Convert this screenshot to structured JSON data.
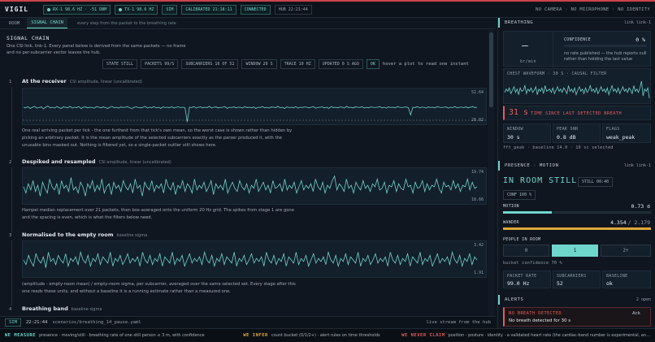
{
  "app": {
    "title": "VIGIL"
  },
  "topbar": {
    "rx": "RX-1 98.6 HZ · -51 DBM",
    "tx": "TX-1 98.6 HZ",
    "sim": "SIM",
    "calibrated": "CALIBRATED 21:18:11",
    "connected": "CONNECTED",
    "hub": "HUB 22:21:44",
    "privacy": "NO CAMERA · NO MICROPHONE · NO IDENTITY"
  },
  "tabs": [
    {
      "label": "ROOM"
    },
    {
      "label": "SIGNAL CHAIN"
    }
  ],
  "tab_desc": "every step from the packet to the breathing rate",
  "chain": {
    "title": "SIGNAL CHAIN",
    "desc": "One CSI link, link-1. Every panel below is derived from the same packets — no frame and no per-subcarrier vector leaves the hub.",
    "status": {
      "state": "STATE STILL",
      "packets": "PACKETS 99/S",
      "subcarriers": "SUBCARRIERS 10 OF 52",
      "window": "WINDOW 20 S",
      "trace": "TRACE 10 HZ",
      "updated": "UPDATED 0 S AGO",
      "ok": "OK",
      "hint": "hover a plot to read one instant"
    },
    "stages": [
      {
        "num": "1",
        "title": "At the receiver",
        "sub": "CSI amplitude, linear (uncalibrated)",
        "max": "52.64",
        "min": "28.82",
        "desc": "One real arriving packet per tick - the one furthest from that tick's own mean, so the worst case is shown rather than hidden by picking an arbitrary packet. It is the mean amplitude of the selected subcarriers exactly as the parser produced it, with the unusable bins masked out. Nothing is filtered yet, so a single-packet outlier still shows here."
      },
      {
        "num": "2",
        "title": "Despiked and resampled",
        "sub": "CSI amplitude, linear (uncalibrated)",
        "max": "19.74",
        "min": "18.66",
        "desc": "Hampel median replacement over 21 packets, then box-averaged onto the uniform 20 Hz grid. The spikes from stage 1 are gone and the spacing is even, which is what the filters below need."
      },
      {
        "num": "3",
        "title": "Normalised to the empty room",
        "sub": "baseline sigma",
        "max": "3.42",
        "min": "1.91",
        "desc": "(amplitude - empty-room mean) / empty-room sigma, per subcarrier, averaged over the same selected set. Every stage after this one reads these units, and without a baseline it is a running estimate rather than a measured one."
      },
      {
        "num": "4",
        "title": "Breathing band",
        "sub": "baseline sigma"
      }
    ]
  },
  "replay": {
    "sim": "SIM",
    "time": "22:21:44",
    "file": "scenarios/breathing_14_pause.yaml",
    "live": "live stream from the hub"
  },
  "breathing": {
    "header": "BREATHING",
    "link": "link link-1",
    "rate": "—",
    "unit": "br/min",
    "confidence_label": "CONFIDENCE",
    "confidence_value": "0 %",
    "confidence_fill": 0,
    "note": "no rate published — the hub reports null rather than holding the last value",
    "waveform_label": "CHEST WAVEFORM · 30 S · CAUSAL FILTER",
    "time_since": "31 s",
    "time_since_label": "TIME SINCE LAST DETECTED BREATH",
    "window_label": "WINDOW",
    "window_value": "30 s",
    "snr_label": "PEAK SNR",
    "snr_value": "0.8 dB",
    "flags_label": "FLAGS",
    "flags_value": "weak_peak",
    "method": "fft_peak · baseline 14.0 · 10 sc selected"
  },
  "presence": {
    "header": "PRESENCE · MOTION",
    "link": "link link-1",
    "state": "IN ROOM STILL",
    "still": "STILL 00:40",
    "conf": "CONF 100 %",
    "motion_label": "MOTION",
    "motion_value": "0.73 σ",
    "wander_label": "WANDER",
    "wander_value": "4.354",
    "wander_max": "/ 2.179",
    "people_label": "PEOPLE IN ROOM",
    "people_options": [
      "0",
      "1",
      "2+"
    ],
    "people_selected": 1,
    "bucket": "bucket confidence 70 %",
    "packet_rate_label": "PACKET RATE",
    "packet_rate_value": "99.0 Hz",
    "subcarriers_label": "SUBCARRIERS",
    "subcarriers_value": "52",
    "baseline_label": "BASELINE",
    "baseline_value": "ok"
  },
  "alerts": {
    "header": "ALERTS",
    "count": "2 open",
    "items": [
      {
        "title": "NO BREATH DETECTED",
        "body": "No breath detected for 30 s",
        "action": "Ack"
      }
    ]
  },
  "footer": {
    "measure_key": "WE MEASURE",
    "measure": "presence · moving/still · breathing rate of one still person ≤ 3 m, with confidence",
    "infer_key": "WE INFER",
    "infer": "count bucket (0/1/2+) · alert rules on time thresholds",
    "claim_key": "WE NEVER CLAIM",
    "claim": "position · posture · identity · a validated heart rate (the cardiac-band number is experimental, an…"
  },
  "colors": {
    "accent": "#6fd6cc",
    "alert": "#e55b5b",
    "warn": "#e0a93a",
    "background": "#0f1620"
  },
  "traces": {
    "stage1": [
      0.5,
      0.48,
      0.52,
      0.46,
      0.5,
      0.53,
      0.47,
      0.49,
      0.51,
      0.45,
      0.5,
      0.54,
      0.48,
      0.5,
      0.47,
      0.52,
      0.49,
      0.46,
      0.51,
      0.5,
      0.48,
      0.53,
      0.47,
      0.5,
      0.49,
      0.52,
      0.46,
      0.5,
      0.51,
      0.48,
      0.5,
      0.49,
      0.47,
      0.52,
      0.5,
      0.48,
      0.51,
      0.49,
      0.46,
      0.5,
      0.53,
      0.48,
      0.5,
      0.47,
      0.51,
      0.49,
      0.5,
      0.52,
      0.48,
      0.46,
      0.5,
      0.51,
      0.49,
      0.48,
      0.5,
      0.53,
      0.47,
      0.5,
      0.49,
      0.52,
      0.48,
      0.5,
      0.46,
      0.51,
      0.49,
      0.5,
      0.48,
      0.52,
      0.47,
      0.5,
      0.51,
      0.49,
      0.5,
      0.48,
      0.02,
      0.5,
      0.49,
      0.52,
      0.47,
      0.5,
      0.51,
      0.48,
      0.5,
      0.49,
      0.53,
      0.47,
      0.5,
      0.51,
      0.48,
      0.49,
      0.5,
      0.52,
      0.46,
      0.5,
      0.49,
      0.51,
      0.48,
      0.5,
      0.5,
      0.47,
      0.52,
      0.49,
      0.5,
      0.48,
      0.51,
      0.46,
      0.5,
      0.49,
      0.52,
      0.48,
      0.5,
      0.47,
      0.51,
      0.5,
      0.49,
      0.53,
      0.48,
      0.5,
      0.46,
      0.51,
      0.49,
      0.5,
      0.48,
      0.52,
      0.47,
      0.5,
      0.49,
      0.51,
      0.5,
      0.48,
      0.5,
      0.52,
      0.47,
      0.49,
      0.5,
      0.51,
      0.48,
      0.5,
      0.46,
      0.52,
      0.49,
      0.5,
      0.48,
      0.51,
      0.5,
      0.47,
      0.53,
      0.49,
      0.5,
      0.48,
      0.51,
      0.5,
      0.49,
      0.52,
      0.47,
      0.5,
      0.48,
      0.51,
      0.5,
      0.49,
      0.5,
      0.52,
      0.48,
      0.5,
      0.47,
      0.51,
      0.49,
      0.5,
      0.48,
      0.52,
      0.5,
      0.49,
      0.5,
      0.51,
      0.48,
      0.25,
      0.5,
      0.49,
      0.52,
      0.48,
      0.5,
      0.5,
      0.47,
      0.51,
      0.49,
      0.5,
      0.48,
      0.52,
      0.5,
      0.49,
      0.5,
      0.51,
      0.47,
      0.5,
      0.49,
      0.52,
      0.48,
      0.5,
      0.5,
      0.49,
      0.51,
      0.48,
      0.5,
      0.52,
      0.49,
      0.5
    ],
    "stage2": [
      0.5,
      0.3,
      0.6,
      0.4,
      0.7,
      0.35,
      0.55,
      0.2,
      0.65,
      0.45,
      0.3,
      0.75,
      0.5,
      0.4,
      0.6,
      0.25,
      0.7,
      0.45,
      0.55,
      0.35,
      0.8,
      0.4,
      0.5,
      0.3,
      0.65,
      0.5,
      0.2,
      0.6,
      0.45,
      0.7,
      0.35,
      0.55,
      0.4,
      0.75,
      0.3,
      0.5,
      0.6,
      0.25,
      0.65,
      0.45,
      0.55,
      0.35,
      0.7,
      0.5,
      0.4,
      0.6,
      0.3,
      0.75,
      0.45,
      0.55,
      0.2,
      0.65,
      0.5,
      0.4,
      0.7,
      0.35,
      0.55,
      0.45,
      0.6,
      0.3,
      0.75,
      0.5,
      0.4,
      0.65,
      0.25,
      0.55,
      0.45,
      0.7,
      0.35,
      0.6,
      0.5,
      0.3,
      0.75,
      0.4,
      0.55,
      0.45,
      0.65,
      0.35,
      0.5,
      0.7,
      0.25,
      0.6,
      0.45,
      0.55,
      0.4,
      0.75,
      0.3,
      0.5,
      0.65,
      0.45,
      0.35,
      0.7,
      0.5,
      0.4,
      0.6,
      0.3,
      0.55,
      0.45,
      0.75,
      0.35,
      0.5,
      0.65,
      0.4,
      0.55,
      0.3,
      0.7,
      0.45,
      0.5,
      0.6,
      0.35,
      0.75,
      0.4,
      0.55,
      0.45,
      0.65,
      0.3,
      0.5,
      0.7,
      0.4,
      0.55,
      0.45,
      0.6,
      0.35,
      0.75,
      0.5,
      0.4,
      0.65,
      0.3,
      0.55,
      0.45,
      0.7,
      0.85,
      0.4,
      0.6,
      0.5,
      0.35,
      0.75,
      0.45,
      0.55,
      0.3,
      0.65,
      0.5,
      0.4,
      0.7,
      0.45,
      0.55,
      0.35,
      0.6,
      0.5,
      0.75,
      0.4,
      0.45,
      0.65,
      0.3,
      0.55,
      0.5,
      0.7,
      0.35,
      0.6,
      0.45,
      0.4,
      0.75,
      0.5,
      0.55,
      0.3,
      0.65,
      0.45,
      0.5,
      0.7,
      0.35,
      0.6,
      0.4,
      0.55,
      0.5,
      0.75,
      0.45,
      0.3,
      0.65,
      0.5,
      0.55,
      0.4,
      0.7,
      0.45,
      0.6,
      0.35,
      0.55,
      0.5,
      0.75,
      0.4,
      0.65,
      0.45,
      0.5
    ],
    "stage3": [
      0.5,
      0.35,
      0.65,
      0.45,
      0.3,
      0.7,
      0.5,
      0.4,
      0.6,
      0.25,
      0.75,
      0.45,
      0.55,
      0.35,
      0.65,
      0.5,
      0.4,
      0.7,
      0.3,
      0.55,
      0.45,
      0.6,
      0.35,
      0.75,
      0.5,
      0.4,
      0.65,
      0.3,
      0.55,
      0.45,
      0.7,
      0.35,
      0.6,
      0.5,
      0.4,
      0.75,
      0.3,
      0.55,
      0.45,
      0.65,
      0.35,
      0.5,
      0.7,
      0.4,
      0.55,
      0.45,
      0.6,
      0.3,
      0.75,
      0.5,
      0.4,
      0.65,
      0.35,
      0.55,
      0.45,
      0.7,
      0.3,
      0.6,
      0.5,
      0.4,
      0.75,
      0.35,
      0.55,
      0.45,
      0.65,
      0.3,
      0.5,
      0.7,
      0.4,
      0.55,
      0.45,
      0.6,
      0.35,
      0.75,
      0.5,
      0.4,
      0.65,
      0.3,
      0.55,
      0.45,
      0.7,
      0.35,
      0.6,
      0.5,
      0.4,
      0.75,
      0.3,
      0.55,
      0.45,
      0.65,
      0.35,
      0.5,
      0.7,
      0.4,
      0.55,
      0.45,
      0.6,
      0.3,
      0.75,
      0.5,
      0.4,
      0.65,
      0.35,
      0.55,
      0.45,
      0.7,
      0.3,
      0.6,
      0.5,
      0.4,
      0.75,
      0.35,
      0.55,
      0.45,
      0.65,
      0.3,
      0.5,
      0.7,
      0.4,
      0.55,
      0.45,
      0.6,
      0.35,
      0.75,
      0.5,
      0.4,
      0.65,
      0.3,
      0.55,
      0.45,
      0.7,
      0.35,
      0.6,
      0.5,
      0.4,
      0.75,
      0.3,
      0.55,
      0.45,
      0.65,
      0.35,
      0.5,
      0.7,
      0.4,
      0.55,
      0.45,
      0.6,
      0.3,
      0.75,
      0.5,
      0.4,
      0.65,
      0.35,
      0.55,
      0.45,
      0.7,
      0.3,
      0.6,
      0.5,
      0.4,
      0.75,
      0.35,
      0.55,
      0.45,
      0.65,
      0.3,
      0.5,
      0.7,
      0.4,
      0.55,
      0.45,
      0.6,
      0.35,
      0.75,
      0.5,
      0.4,
      0.65,
      0.3,
      0.55,
      0.45,
      0.7,
      0.35,
      0.6,
      0.5
    ],
    "chest": [
      0.4,
      0.55,
      0.45,
      0.6,
      0.35,
      0.5,
      0.65,
      0.4,
      0.55,
      0.3,
      0.6,
      0.45,
      0.5,
      0.7,
      0.35,
      0.55,
      0.45,
      0.6,
      0.4,
      0.5,
      0.65,
      0.3,
      0.55,
      0.45,
      0.6,
      0.35,
      0.7,
      0.45,
      0.5,
      0.55,
      0.4,
      0.6,
      0.35,
      0.5,
      0.65,
      0.45,
      0.55,
      0.4,
      0.6,
      0.5,
      0.35,
      0.7,
      0.45,
      0.55,
      0.4,
      0.6,
      0.3,
      0.5,
      0.65,
      0.45,
      0.55,
      0.35,
      0.6,
      0.4,
      0.5,
      0.7,
      0.45,
      0.55,
      0.4,
      0.6,
      0.35,
      0.5,
      0.65,
      0.45,
      0.55,
      0.4,
      0.6,
      0.3,
      0.5,
      0.7,
      0.45,
      0.55,
      0.4,
      0.6,
      0.35,
      0.5,
      0.65,
      0.45,
      0.55,
      0.4,
      0.6,
      0.5,
      0.35,
      0.7,
      0.45,
      0.55,
      0.4,
      0.6,
      0.9,
      0.25,
      0.55,
      0.45,
      0.6,
      0.15
    ]
  }
}
